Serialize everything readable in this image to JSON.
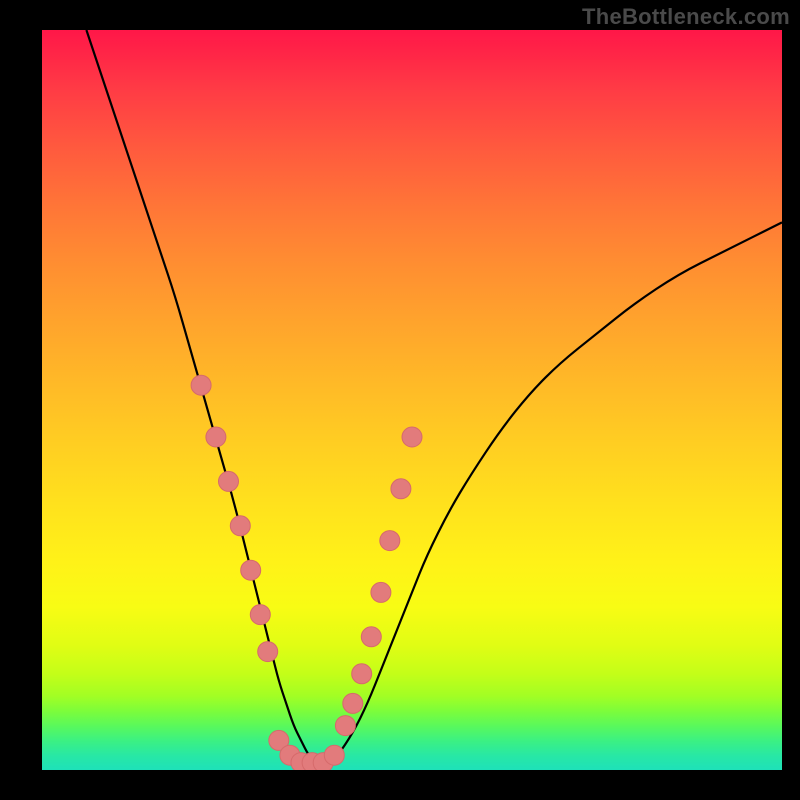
{
  "watermark": "TheBottleneck.com",
  "chart_data": {
    "type": "line",
    "title": "",
    "xlabel": "",
    "ylabel": "",
    "xlim": [
      0,
      100
    ],
    "ylim": [
      0,
      100
    ],
    "grid": false,
    "series": [
      {
        "name": "curve",
        "x": [
          6,
          8,
          10,
          12,
          14,
          16,
          18,
          20,
          22,
          24,
          26,
          28,
          30,
          31,
          32,
          33,
          34,
          35,
          36,
          37,
          38,
          39,
          40,
          42,
          44,
          46,
          48,
          50,
          52,
          55,
          58,
          62,
          66,
          70,
          75,
          80,
          86,
          92,
          100
        ],
        "y": [
          100,
          94,
          88,
          82,
          76,
          70,
          64,
          57,
          50,
          43,
          36,
          28,
          20,
          16,
          12,
          9,
          6,
          4,
          2,
          1,
          1,
          1,
          2,
          5,
          9,
          14,
          19,
          24,
          29,
          35,
          40,
          46,
          51,
          55,
          59,
          63,
          67,
          70,
          74
        ]
      },
      {
        "name": "markers-left",
        "x": [
          21.5,
          23.5,
          25.2,
          26.8,
          28.2,
          29.5,
          30.5
        ],
        "y": [
          52,
          45,
          39,
          33,
          27,
          21,
          16
        ]
      },
      {
        "name": "markers-bottom",
        "x": [
          32,
          33.5,
          35,
          36.5,
          38,
          39.5
        ],
        "y": [
          4,
          2,
          1,
          1,
          1,
          2
        ]
      },
      {
        "name": "markers-right",
        "x": [
          41,
          42,
          43.2,
          44.5,
          45.8,
          47,
          48.5,
          50
        ],
        "y": [
          6,
          9,
          13,
          18,
          24,
          31,
          38,
          45
        ]
      }
    ],
    "colors": {
      "curve": "#000000",
      "marker_fill": "#e27b7c",
      "marker_stroke": "#d66a6b"
    },
    "marker_radius_px": 10
  }
}
